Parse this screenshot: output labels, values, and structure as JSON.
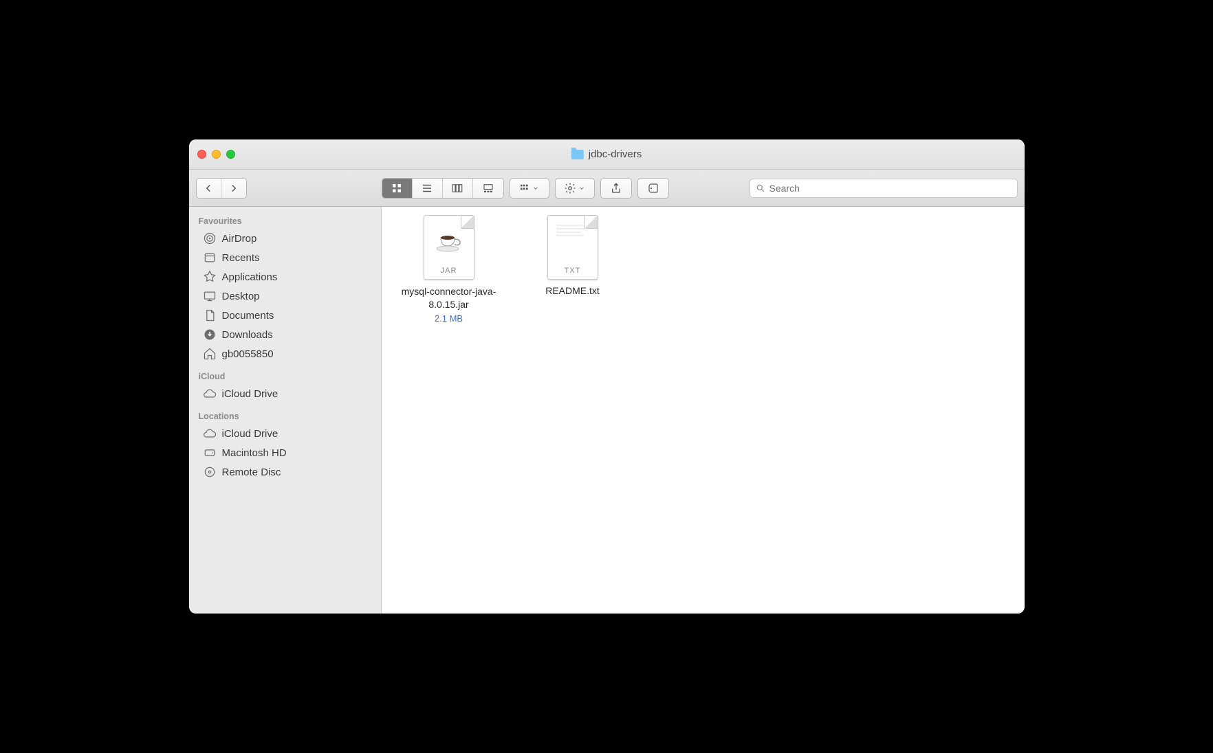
{
  "window": {
    "title": "jdbc-drivers"
  },
  "search": {
    "placeholder": "Search"
  },
  "sidebar": {
    "sections": [
      {
        "heading": "Favourites",
        "items": [
          {
            "label": "AirDrop",
            "icon": "airdrop"
          },
          {
            "label": "Recents",
            "icon": "recents"
          },
          {
            "label": "Applications",
            "icon": "applications"
          },
          {
            "label": "Desktop",
            "icon": "desktop"
          },
          {
            "label": "Documents",
            "icon": "documents"
          },
          {
            "label": "Downloads",
            "icon": "downloads"
          },
          {
            "label": "gb0055850",
            "icon": "home"
          }
        ]
      },
      {
        "heading": "iCloud",
        "items": [
          {
            "label": "iCloud Drive",
            "icon": "cloud"
          }
        ]
      },
      {
        "heading": "Locations",
        "items": [
          {
            "label": "iCloud Drive",
            "icon": "cloud"
          },
          {
            "label": "Macintosh HD",
            "icon": "disk"
          },
          {
            "label": "Remote Disc",
            "icon": "disc"
          }
        ]
      }
    ]
  },
  "files": [
    {
      "name": "mysql-connector-java-8.0.15.jar",
      "ext": "JAR",
      "type": "jar",
      "size": "2.1 MB"
    },
    {
      "name": "README.txt",
      "ext": "TXT",
      "type": "txt"
    }
  ]
}
